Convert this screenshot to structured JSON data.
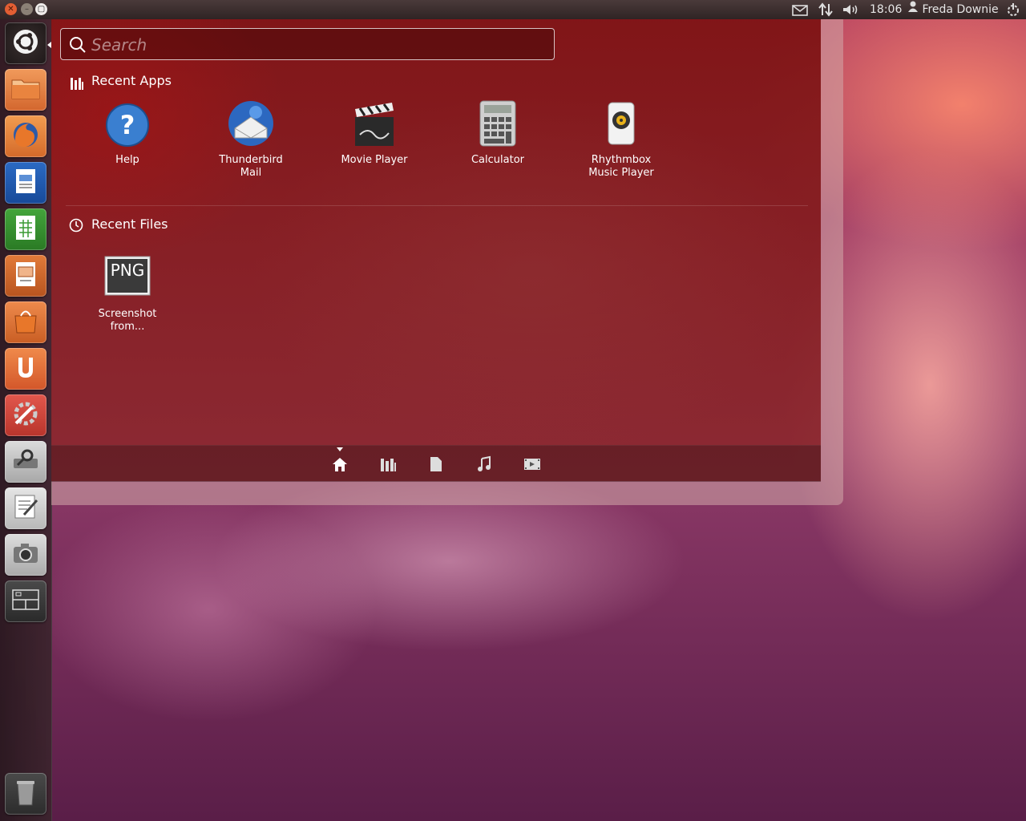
{
  "top_panel": {
    "window_buttons": [
      "close",
      "minimize",
      "maximize"
    ],
    "indicators": {
      "mail_icon": "envelope-icon",
      "network_icon": "network-arrows-icon",
      "volume_icon": "volume-icon",
      "time": "18:06",
      "user": "Freda Downie",
      "session_icon": "power-gear-icon"
    }
  },
  "launcher": {
    "items": [
      {
        "name": "dash-home",
        "icon": "ubuntu-logo-icon"
      },
      {
        "name": "files",
        "icon": "folder-icon"
      },
      {
        "name": "firefox",
        "icon": "firefox-icon"
      },
      {
        "name": "libreoffice-writer",
        "icon": "writer-icon"
      },
      {
        "name": "libreoffice-calc",
        "icon": "calc-icon"
      },
      {
        "name": "libreoffice-impress",
        "icon": "impress-icon"
      },
      {
        "name": "software-center",
        "icon": "shopping-bag-icon"
      },
      {
        "name": "ubuntu-one",
        "icon": "ubuntu-one-icon"
      },
      {
        "name": "system-settings",
        "icon": "settings-wrench-icon"
      },
      {
        "name": "disk-utility",
        "icon": "disk-utility-icon"
      },
      {
        "name": "text-editor",
        "icon": "text-editor-icon"
      },
      {
        "name": "camera",
        "icon": "camera-icon"
      },
      {
        "name": "workspace-switcher",
        "icon": "workspace-icon"
      },
      {
        "name": "trash",
        "icon": "trash-icon"
      }
    ]
  },
  "dash": {
    "search": {
      "placeholder": "Search",
      "value": ""
    },
    "recent_apps": {
      "title": "Recent Apps",
      "items": [
        {
          "label_1": "Help",
          "label_2": "",
          "icon": "help-icon"
        },
        {
          "label_1": "Thunderbird",
          "label_2": "Mail",
          "icon": "thunderbird-icon"
        },
        {
          "label_1": "Movie Player",
          "label_2": "",
          "icon": "clapperboard-icon"
        },
        {
          "label_1": "Calculator",
          "label_2": "",
          "icon": "calculator-icon"
        },
        {
          "label_1": "Rhythmbox",
          "label_2": "Music Player",
          "icon": "speaker-icon"
        }
      ]
    },
    "recent_files": {
      "title": "Recent Files",
      "items": [
        {
          "thumb_text": "PNG",
          "label_1": "Screenshot",
          "label_2": "from...",
          "icon": "png-file-icon"
        }
      ]
    },
    "lens_bar": {
      "active": "home",
      "lenses": [
        "home",
        "applications",
        "files",
        "music",
        "video"
      ]
    }
  },
  "colors": {
    "dash_red": "#8a1a1a",
    "ubuntu_orange": "#e35e33",
    "text": "#ffffff"
  }
}
